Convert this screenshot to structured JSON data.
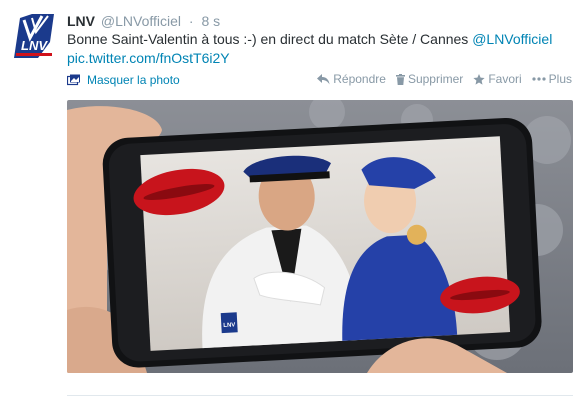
{
  "tweet": {
    "account": {
      "logo_text": "LNV",
      "name": "LNV",
      "handle": "@LNVofficiel",
      "separator": "·",
      "time": "8 s"
    },
    "text_main": "Bonne Saint-Valentin à tous :-) en direct du match Sète / Cannes ",
    "mention": "@LNVofficiel",
    "photo_link": "pic.twitter.com/fnOstT6i2Y",
    "hide_photo": "Masquer la photo",
    "actions": {
      "reply": "Répondre",
      "delete": "Supprimer",
      "favorite": "Favori",
      "more": "Plus"
    },
    "photo": {
      "badge": "LNV"
    }
  },
  "colors": {
    "link": "#0084b4",
    "muted": "#8899a6",
    "text": "#292f33",
    "brand_blue": "#1b3a8c",
    "brand_red": "#d0121b"
  },
  "icons": {
    "reply": "reply-icon",
    "delete": "trash-icon",
    "favorite": "star-icon",
    "more": "more-dots-icon",
    "media": "photo-icon"
  }
}
